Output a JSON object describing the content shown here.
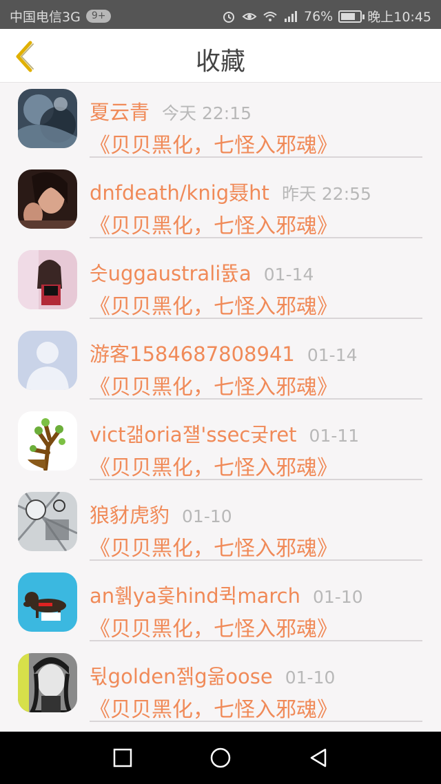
{
  "status_bar": {
    "carrier": "中国电信3G",
    "badge": "9+",
    "battery": "76%",
    "battery_level": 0.76,
    "time": "晚上10:45",
    "network": "3G"
  },
  "header": {
    "title": "收藏",
    "back_icon": "chevron-left-icon"
  },
  "favorites": [
    {
      "name": "夏云青",
      "time": "今天 22:15",
      "work": "《贝贝黑化，七怪入邪魂》",
      "avatar": "avatar-blue-texture"
    },
    {
      "name": "dnfdeath/knig聂ht",
      "time": "昨天 22:55",
      "work": "《贝贝黑化，七怪入邪魂》",
      "avatar": "avatar-woman-photo"
    },
    {
      "name": "숫uggaustrali뜘a",
      "time": "01-14",
      "work": "《贝贝黑化，七怪入邪魂》",
      "avatar": "avatar-girl-pink"
    },
    {
      "name": "游客1584687808941",
      "time": "01-14",
      "work": "《贝贝黑化，七怪入邪魂》",
      "avatar": "avatar-default"
    },
    {
      "name": "vict갦oria쟬'ssec궂ret",
      "time": "01-11",
      "work": "《贝贝黑化，七怪入邪魂》",
      "avatar": "avatar-tree"
    },
    {
      "name": "狼豺虎豹",
      "time": "01-10",
      "work": "《贝贝黑化，七怪入邪魂》",
      "avatar": "avatar-sketch"
    },
    {
      "name": "an휅ya훚hind퀵march",
      "time": "01-10",
      "work": "《贝贝黑化，七怪入邪魂》",
      "avatar": "avatar-dog"
    },
    {
      "name": "뒧golden젥g욺oose",
      "time": "01-10",
      "work": "《贝贝黑化，七怪入邪魂》",
      "avatar": "avatar-bw-girl"
    }
  ],
  "nav": {
    "recents_icon": "square-icon",
    "home_icon": "circle-icon",
    "back_icon": "triangle-back-icon"
  },
  "colors": {
    "accent": "#f08a58",
    "time_gray": "#b8b8b8",
    "back_arrow": "#e0b000",
    "statusbar": "#555555"
  }
}
